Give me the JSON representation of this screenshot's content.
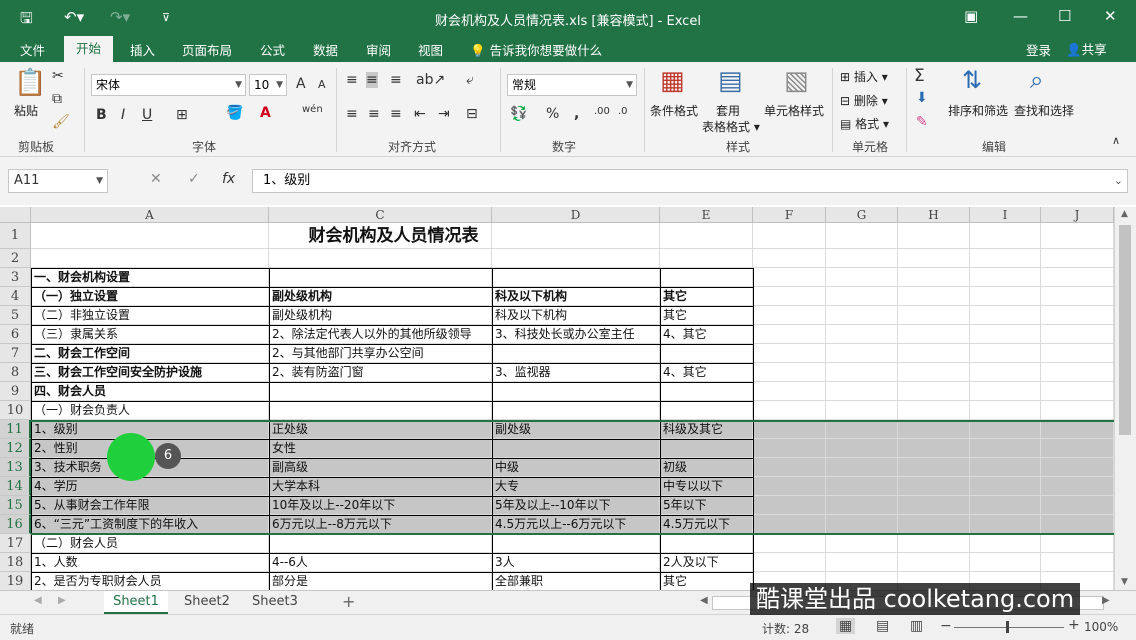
{
  "titlebar": {
    "title": "财会机构及人员情况表.xls  [兼容模式] - Excel",
    "save_icon": "save-icon",
    "undo_icon": "undo-icon",
    "redo_icon": "redo-icon",
    "customize_icon": "customize-qat-icon",
    "restore_ribbon": "▣",
    "minimize": "—",
    "maximize": "☐",
    "close": "✕",
    "accent": "#217346"
  },
  "menu": {
    "tabs": [
      "文件",
      "开始",
      "插入",
      "页面布局",
      "公式",
      "数据",
      "审阅",
      "视图"
    ],
    "active": "开始",
    "tellme": "告诉我你想要做什么",
    "login": "登录",
    "share": "共享"
  },
  "ribbon": {
    "clipboard": {
      "paste": "粘贴",
      "label": "剪贴板"
    },
    "font": {
      "name": "宋体",
      "size": "10",
      "label": "字体",
      "bold": "B",
      "italic": "I",
      "underline": "U",
      "grow": "A",
      "shrink": "A",
      "wen": "wén"
    },
    "align": {
      "label": "对齐方式"
    },
    "number": {
      "format": "常规",
      "label": "数字",
      "percent": "%",
      "comma": ","
    },
    "styles": {
      "cond": "条件格式",
      "table": "套用\n表格格式",
      "cell": "单元格样式",
      "label": "样式"
    },
    "cells": {
      "insert": "插入",
      "delete": "删除",
      "format": "格式",
      "label": "单元格"
    },
    "edit": {
      "sort": "排序和筛选",
      "find": "查找和选择",
      "label": "编辑",
      "sigma": "Σ"
    }
  },
  "formula": {
    "namebox": "A11",
    "cancel": "✕",
    "enter": "✓",
    "fx": "fx",
    "value": "1、级别"
  },
  "columns": [
    "A",
    "C",
    "D",
    "E",
    "F",
    "G",
    "H",
    "I",
    "J"
  ],
  "rows": [
    {
      "n": "1",
      "a": "",
      "c": "",
      "d": "",
      "e": ""
    },
    {
      "n": "2",
      "a": "",
      "c": "",
      "d": "",
      "e": ""
    },
    {
      "n": "3",
      "a": "一、财会机构设置",
      "c": "",
      "d": "",
      "e": ""
    },
    {
      "n": "4",
      "a": "（一）独立设置",
      "c": "副处级机构",
      "d": "科及以下机构",
      "e": "其它"
    },
    {
      "n": "5",
      "a": "（二）非独立设置",
      "c": "副处级机构",
      "d": "科及以下机构",
      "e": "其它"
    },
    {
      "n": "6",
      "a": "（三）隶属关系",
      "c": "2、除法定代表人以外的其他所级领导",
      "d": "3、科技处长或办公室主任",
      "e": "4、其它"
    },
    {
      "n": "7",
      "a": "二、财会工作空间",
      "c": "2、与其他部门共享办公空间",
      "d": "",
      "e": ""
    },
    {
      "n": "8",
      "a": "三、财会工作空间安全防护设施",
      "c": "2、装有防盗门窗",
      "d": "3、监视器",
      "e": "4、其它"
    },
    {
      "n": "9",
      "a": "四、财会人员",
      "c": "",
      "d": "",
      "e": ""
    },
    {
      "n": "10",
      "a": "（一）财会负责人",
      "c": "",
      "d": "",
      "e": ""
    },
    {
      "n": "11",
      "a": "1、级别",
      "c": "正处级",
      "d": "副处级",
      "e": "科级及其它"
    },
    {
      "n": "12",
      "a": "2、性别",
      "c": "女性",
      "d": "",
      "e": ""
    },
    {
      "n": "13",
      "a": "3、技术职务",
      "c": "副高级",
      "d": "中级",
      "e": "初级"
    },
    {
      "n": "14",
      "a": "4、学历",
      "c": "大学本科",
      "d": "大专",
      "e": "中专以以下"
    },
    {
      "n": "15",
      "a": "5、从事财会工作年限",
      "c": "10年及以上--20年以下",
      "d": "5年及以上--10年以下",
      "e": "5年以下"
    },
    {
      "n": "16",
      "a": "6、“三元”工资制度下的年收入",
      "c": "6万元以上--8万元以下",
      "d": "4.5万元以上--6万元以下",
      "e": "4.5万元以下"
    },
    {
      "n": "17",
      "a": "（二）财会人员",
      "c": "",
      "d": "",
      "e": ""
    },
    {
      "n": "18",
      "a": "1、人数",
      "c": "4--6人",
      "d": "3人",
      "e": "2人及以下"
    },
    {
      "n": "19",
      "a": "2、是否为专职财会人员",
      "c": "部分是",
      "d": "全部兼职",
      "e": "其它"
    }
  ],
  "sheet_title": "财会机构及人员情况表",
  "sheets": [
    "Sheet1",
    "Sheet2",
    "Sheet3"
  ],
  "active_sheet": "Sheet1",
  "add_sheet": "+",
  "status": {
    "ready": "就绪",
    "count": "计数: 28",
    "zoom": "100%",
    "minus": "−",
    "plus": "+"
  },
  "watermark": "酷课堂出品 coolketang.com",
  "click_badge": "6"
}
